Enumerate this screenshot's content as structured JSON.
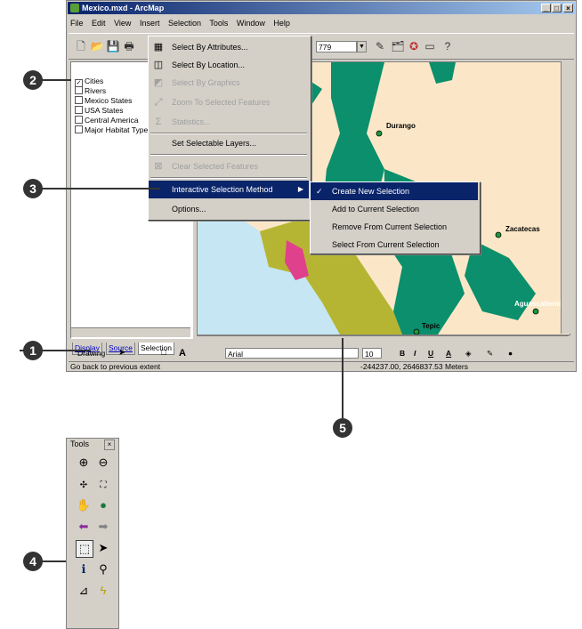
{
  "window": {
    "title": "Mexico.mxd - ArcMap",
    "min": "_",
    "max": "□",
    "close": "×"
  },
  "menubar": [
    "File",
    "Edit",
    "View",
    "Insert",
    "Selection",
    "Tools",
    "Window",
    "Help"
  ],
  "toolbar": {
    "scale_value": "779",
    "scale_dropdown_icon": "chevron-down-icon"
  },
  "toc": {
    "layers": [
      {
        "label": "Cities",
        "checked": true
      },
      {
        "label": "Rivers",
        "checked": false
      },
      {
        "label": "Mexico States",
        "checked": false
      },
      {
        "label": "USA States",
        "checked": false
      },
      {
        "label": "Central America",
        "checked": false
      },
      {
        "label": "Major Habitat Types",
        "checked": false
      }
    ],
    "tabs": [
      "Display",
      "Source",
      "Selection"
    ]
  },
  "selection_menu": {
    "items": [
      {
        "label": "Select By Attributes...",
        "icon": "table-select-icon",
        "enabled": true
      },
      {
        "label": "Select By Location...",
        "icon": "location-select-icon",
        "enabled": true
      },
      {
        "label": "Select By Graphics",
        "icon": "graphics-select-icon",
        "enabled": false
      },
      {
        "label": "Zoom To Selected Features",
        "icon": "zoom-selected-icon",
        "enabled": false
      },
      {
        "label": "Statistics...",
        "icon": "sigma-icon",
        "enabled": false
      },
      {
        "label": "Set Selectable Layers...",
        "enabled": true
      },
      {
        "label": "Clear Selected Features",
        "icon": "clear-selection-icon",
        "enabled": false
      },
      {
        "label": "Interactive Selection Method",
        "enabled": true,
        "highlighted": true
      },
      {
        "label": "Options...",
        "enabled": true
      }
    ]
  },
  "submenu": {
    "items": [
      {
        "label": "Create New Selection",
        "checked": true,
        "highlighted": true
      },
      {
        "label": "Add to Current Selection"
      },
      {
        "label": "Remove From Current Selection"
      },
      {
        "label": "Select From Current Selection"
      }
    ]
  },
  "map": {
    "cities": [
      "Durango",
      "Zacatecas",
      "Aguascaliente",
      "Tepic"
    ],
    "colors": {
      "land": "#fbe7c7",
      "forest": "#0b8f6c",
      "grassland": "#b5b533",
      "water": "#c5e6f2",
      "magenta": "#e0418c"
    }
  },
  "drawing_toolbar": {
    "drawing_label": "Drawing",
    "font": "Arial",
    "size": "10",
    "bold": "B",
    "italic": "I",
    "underline": "U"
  },
  "status": {
    "hint": "Go back to previous extent",
    "coords": "-244237.00, 2646837.53 Meters"
  },
  "tools_panel": {
    "title": "Tools",
    "close": "×"
  },
  "callouts": [
    "1",
    "2",
    "3",
    "4",
    "5"
  ]
}
